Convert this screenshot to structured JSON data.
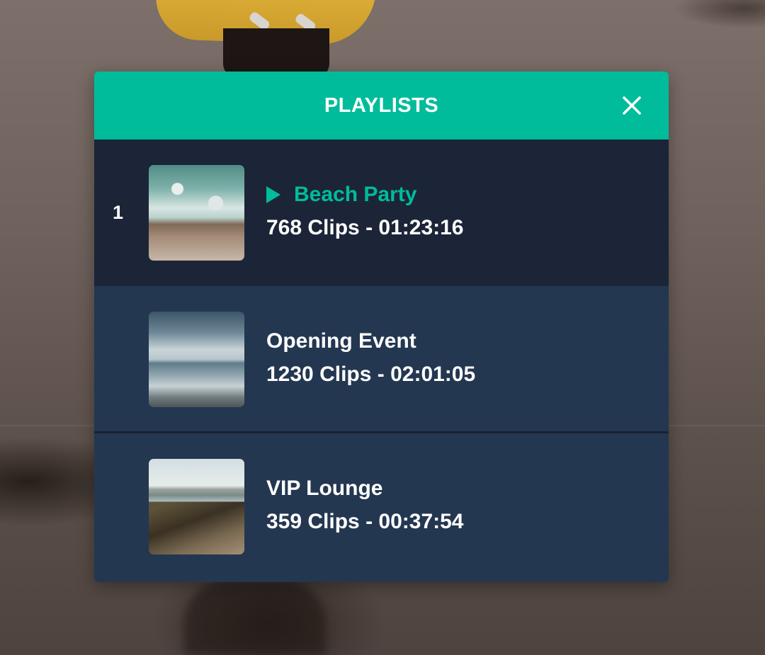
{
  "panel": {
    "title": "PLAYLISTS",
    "close_icon": "close-icon"
  },
  "playlists": [
    {
      "index": "1",
      "name": "Beach Party",
      "meta": "768 Clips - 01:23:16",
      "active": true,
      "thumbnail": "aerial beach waves"
    },
    {
      "index": "",
      "name": "Opening Event",
      "meta": "1230 Clips - 02:01:05",
      "active": false,
      "thumbnail": "cloudy sea shore"
    },
    {
      "index": "",
      "name": "VIP Lounge",
      "meta": "359 Clips - 00:37:54",
      "active": false,
      "thumbnail": "rocky coastline"
    }
  ],
  "colors": {
    "accent": "#00bc9b",
    "panel_bg": "#243750",
    "active_row_bg": "#1c2537",
    "text": "#ffffff"
  }
}
